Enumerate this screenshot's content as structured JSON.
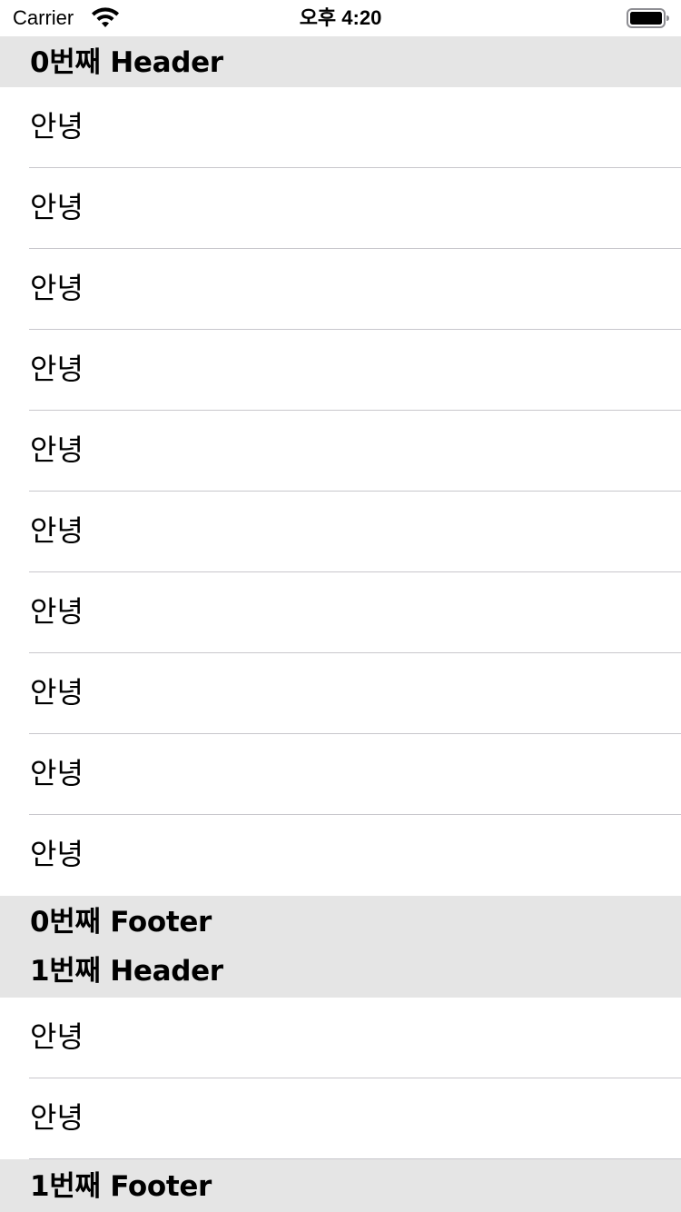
{
  "status_bar": {
    "carrier": "Carrier",
    "time": "오후 4:20",
    "wifi_icon": "wifi-icon",
    "battery_icon": "battery-icon"
  },
  "sections": [
    {
      "header": "0번째 Header",
      "rows": [
        "안녕",
        "안녕",
        "안녕",
        "안녕",
        "안녕",
        "안녕",
        "안녕",
        "안녕",
        "안녕",
        "안녕"
      ],
      "footer": "0번째 Footer"
    },
    {
      "header": "1번째 Header",
      "rows": [
        "안녕",
        "안녕"
      ],
      "footer": "1번째 Footer"
    }
  ],
  "colors": {
    "section_background": "#e5e5e5",
    "separator": "#c8c7cc",
    "row_background": "#ffffff"
  }
}
